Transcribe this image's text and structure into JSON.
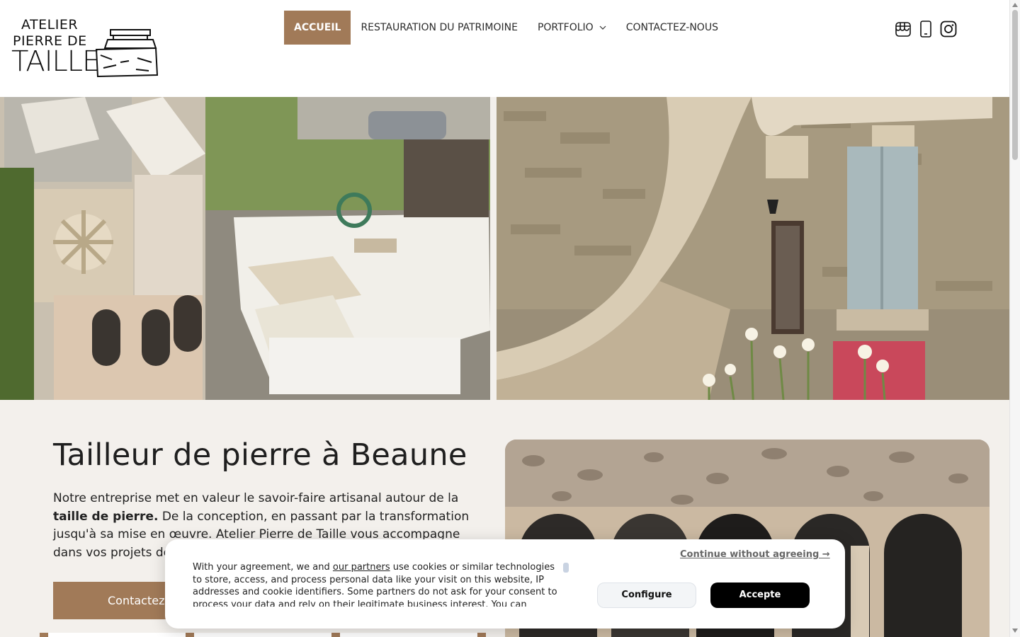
{
  "logo": {
    "line1": "ATELIER",
    "line2": "PIERRE DE",
    "line3": "TAILLE"
  },
  "nav": {
    "items": [
      {
        "label": "ACCUEIL",
        "active": true
      },
      {
        "label": "RESTAURATION DU PATRIMOINE",
        "active": false
      },
      {
        "label": "PORTFOLIO",
        "active": false,
        "has_dropdown": true
      },
      {
        "label": "CONTACTEZ-NOUS",
        "active": false
      }
    ]
  },
  "social": [
    "google-business-icon",
    "phone-icon",
    "instagram-icon"
  ],
  "main": {
    "title": "Tailleur de pierre à Beaune",
    "intro_part1": "Notre entreprise met en valeur le savoir-faire artisanal autour de la ",
    "intro_bold": "taille de pierre.",
    "intro_part2": " De la conception, en passant par la transformation jusqu'à sa mise en œuvre. Atelier Pierre de Taille vous accompagne dans vos projets de",
    "cta_label": "Contactez-"
  },
  "cookie": {
    "text_before": "With your agreement, we and ",
    "partners_link": "our partners",
    "text_after": " use cookies or similar technologies to store, access, and process personal data like your visit on this website, IP addresses and cookie identifiers. Some partners do not ask for your consent to process your data and rely on their legitimate business interest. You can",
    "continue_label": "Continue without agreeing →",
    "configure_label": "Configure",
    "accept_label": "Accepte"
  },
  "colors": {
    "accent": "#a17a58",
    "accept_bg": "#000000",
    "page_bg": "#f3f0ec"
  }
}
